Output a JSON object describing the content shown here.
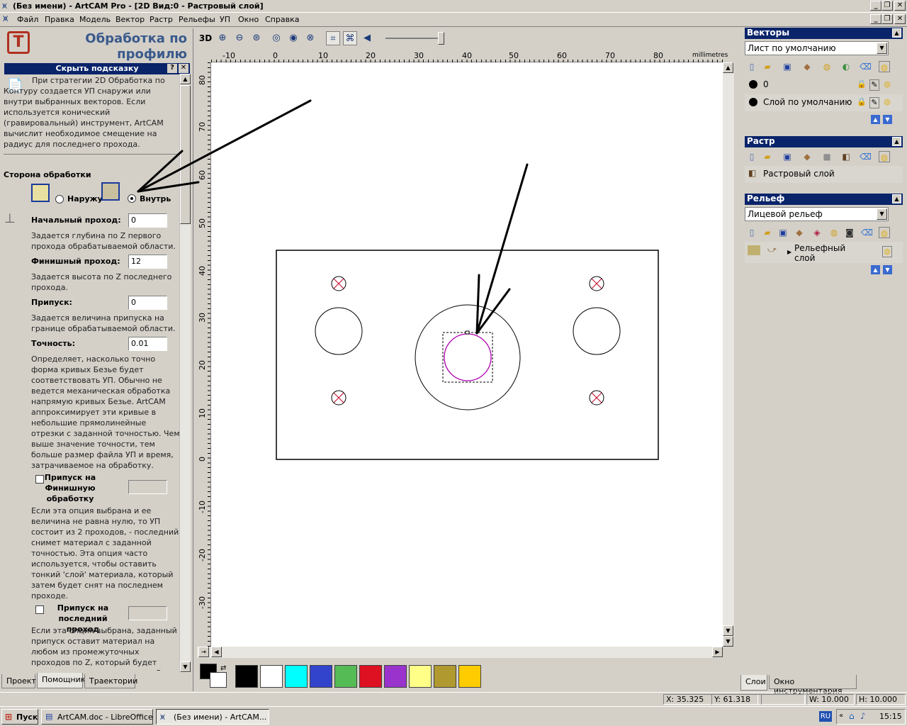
{
  "window": {
    "title": "(Без имени) - ArtCAM Pro - [2D Вид:0 - Растровый слой]"
  },
  "menu": [
    "Файл",
    "Правка",
    "Модель",
    "Вектор",
    "Растр",
    "Рельефы",
    "УП",
    "Окно",
    "Справка"
  ],
  "left_panel": {
    "title_line1": "Обработка по",
    "title_line2": "профилю",
    "hint_bar": "Скрыть подсказку",
    "hint_text": "При стратегии 2D Обработка по Контуру создается УП снаружи или внутри выбранных векторов. Если используется конический (гравировальный) инструмент, ArtCAM вычислит необходимое смещение на радиус для последнего прохода.",
    "side_label": "Сторона обработки",
    "side_outside": "Наружу",
    "side_inside": "Внутрь",
    "start_pass_label": "Начальный проход:",
    "start_pass_value": "0",
    "start_pass_desc": "Задается глубина по Z первого прохода обрабатываемой области.",
    "finish_pass_label": "Финишный проход:",
    "finish_pass_value": "12",
    "finish_pass_desc": "Задается высота по Z последнего прохода.",
    "allowance_label": "Припуск:",
    "allowance_value": "0",
    "allowance_desc": "Задается величина припуска на границе обрабатываемой области.",
    "tolerance_label": "Точность:",
    "tolerance_value": "0.01",
    "tolerance_desc": "Определяет, насколько точно форма кривых Безье будет соответствовать УП. Обычно не ведется механическая обработка напрямую кривых Безье. ArtCAM аппроксимирует эти кривые в небольшие прямолинейные отрезки с заданной точностью. Чем выше значение точности, тем больше размер файла УП и время, затрачиваемое на обработку.",
    "finish_allowance_label": "Припуск на Финишную обработку",
    "finish_allowance_desc": "Если эта опция выбрана и ее величина не равна нулю, то УП состоит из 2 проходов, - последний снимет материал с заданной точностью. Эта опция часто используется, чтобы оставить тонкий 'слой' материала, который затем будет снят на последнем проходе.",
    "last_pass_label": "Припуск на последний проход",
    "last_pass_desc": "Если эта опция выбрана, заданный припуск оставит материал на любом из промежуточных проходов по Z, который будет удален последним проходом. Эта опция",
    "tabs": [
      "Проект",
      "Помощник",
      "Траектории"
    ]
  },
  "toolbar": {
    "btn_3d": "3D"
  },
  "ruler": {
    "top_ticks": [
      "-10",
      "0",
      "10",
      "20",
      "30",
      "40",
      "50",
      "60",
      "70",
      "80"
    ],
    "units": "millimetres",
    "left_ticks": [
      "80",
      "70",
      "60",
      "50",
      "40",
      "30",
      "20",
      "10",
      "0",
      "-10",
      "-20",
      "-30"
    ]
  },
  "palette": [
    "#000000",
    "#ffffff",
    "#00ffff",
    "#3344cc",
    "#55bb55",
    "#dd1122",
    "#9933cc",
    "#ffff88",
    "#b09a30",
    "#ffcc00"
  ],
  "right_panel": {
    "vectors_header": "Векторы",
    "vectors_dropdown": "Лист по умолчанию",
    "vector_layer_1": "0",
    "vector_layer_2": "Слой по умолчанию",
    "raster_header": "Растр",
    "raster_layer": "Растровый слой",
    "relief_header": "Рельеф",
    "relief_dropdown": "Лицевой рельеф",
    "relief_layer": "Рельефный слой",
    "tabs": [
      "Слои",
      "Окно инструментария"
    ]
  },
  "status": {
    "x": "X: 35.325",
    "y": "Y: 61.318",
    "w": "W: 10.000",
    "h": "H: 10.000"
  },
  "taskbar": {
    "start": "Пуск",
    "task1": "ArtCAM.doc - LibreOffice...",
    "task2": "(Без имени) - ArtCAM...",
    "lang": "RU",
    "clock": "15:15"
  }
}
